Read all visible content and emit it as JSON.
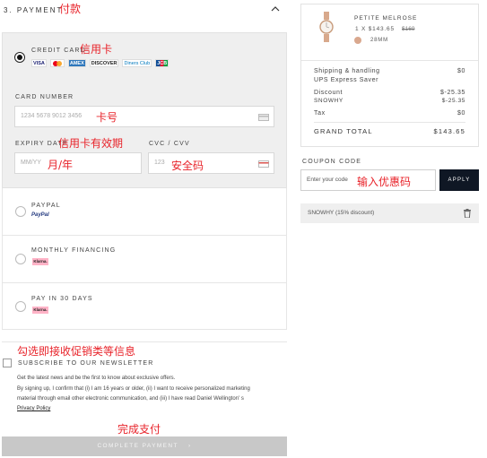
{
  "payment": {
    "title": "3. PAYMENT",
    "annotation": "付款",
    "credit_card": {
      "label": "CREDIT CARD",
      "annotation": "信用卡",
      "brands": [
        "VISA",
        "MC",
        "AMEX",
        "DISCOVER",
        "Diners Club",
        "JCB"
      ],
      "number_label": "CARD NUMBER",
      "number_placeholder": "1234 5678 9012 3456",
      "number_annotation": "卡号",
      "expiry_label": "EXPIRY DATE",
      "expiry_annotation": "信用卡有效期",
      "expiry_placeholder": "MM/YY",
      "expiry_field_annotation": "月/年",
      "cvc_label": "CVC / CVV",
      "cvc_placeholder": "123",
      "cvc_annotation": "安全码"
    },
    "paypal": {
      "label": "PAYPAL",
      "logo_text": "PayPal"
    },
    "financing": {
      "label": "MONTHLY FINANCING",
      "logo_text": "Klarna."
    },
    "pay30": {
      "label": "PAY IN 30 DAYS",
      "logo_text": "Klarna."
    }
  },
  "newsletter": {
    "annotation": "勾选即接收促销类等信息",
    "label": "SUBSCRIBE TO OUR NEWSLETTER",
    "text1": "Get the latest news and be the first to know about exclusive offers.",
    "text2": "By signing up, I confirm that (i) I am 16 years or older, (ii) I want to receive personalized marketing",
    "text3": "material through email other electronic communication, and (iii) I have read Daniel Wellington' s",
    "privacy": "Privacy Policy"
  },
  "complete": {
    "annotation": "完成支付",
    "label": "COMPLETE PAYMENT"
  },
  "summary": {
    "product_name": "PETITE MELROSE",
    "qty_price": "1 X $143.65",
    "old_price": "$169",
    "size": "28MM",
    "shipping_label": "Shipping & handling",
    "shipping_value": "$0",
    "shipping_method": "UPS Express Saver",
    "discount_label": "Discount",
    "discount_value": "$-25.35",
    "discount_code": "SNOWHY",
    "discount_code_value": "$-25.35",
    "tax_label": "Tax",
    "tax_value": "$0",
    "grand_label": "GRAND TOTAL",
    "grand_value": "$143.65"
  },
  "coupon": {
    "label": "COUPON CODE",
    "placeholder": "Enter your code",
    "annotation": "输入优惠码",
    "apply": "APPLY",
    "applied": "SNOWHY (15% discount)"
  }
}
